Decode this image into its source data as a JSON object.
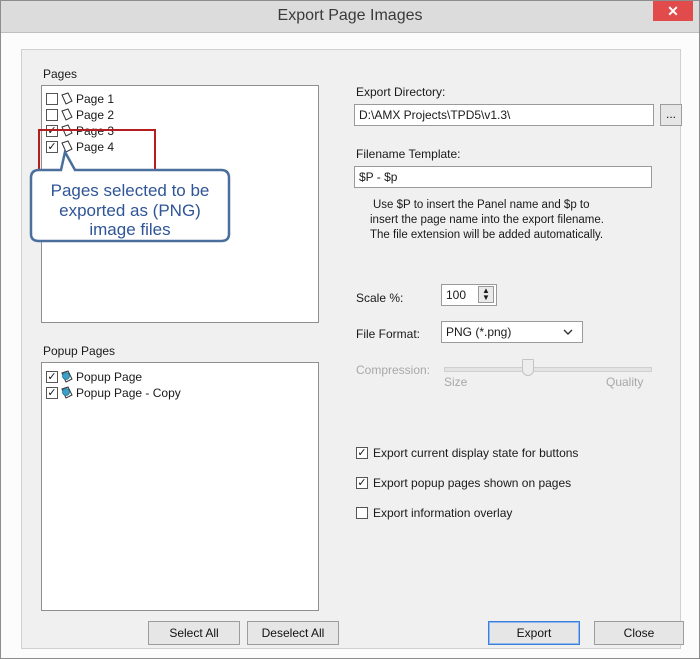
{
  "window": {
    "title": "Export Page Images",
    "close_glyph": "✕"
  },
  "pages": {
    "label": "Pages",
    "items": [
      {
        "label": "Page 1",
        "checked": false
      },
      {
        "label": "Page 2",
        "checked": false
      },
      {
        "label": "Page 3",
        "checked": true
      },
      {
        "label": "Page 4",
        "checked": true
      }
    ],
    "callout": [
      "Pages selected to be",
      "exported as (PNG)",
      "image files"
    ]
  },
  "popup_pages": {
    "label": "Popup Pages",
    "items": [
      {
        "label": "Popup Page",
        "checked": true
      },
      {
        "label": "Popup Page - Copy",
        "checked": true
      }
    ]
  },
  "export_directory": {
    "label": "Export Directory:",
    "value": "D:\\AMX Projects\\TPD5\\v1.3\\",
    "browse_label": "..."
  },
  "filename_template": {
    "label": "Filename Template:",
    "value": "$P - $p",
    "help": [
      "Use $P to insert the Panel name and $p to",
      "insert the page name into the export filename.",
      "The file extension will be added automatically."
    ]
  },
  "scale": {
    "label": "Scale %:",
    "value": "100"
  },
  "file_format": {
    "label": "File Format:",
    "value": "PNG (*.png)"
  },
  "compression": {
    "label": "Compression:",
    "min_label": "Size",
    "max_label": "Quality",
    "level": 0.4
  },
  "options": [
    {
      "label": "Export current display state for buttons",
      "checked": true
    },
    {
      "label": "Export popup pages shown on pages",
      "checked": true
    },
    {
      "label": "Export information overlay",
      "checked": false
    }
  ],
  "buttons": {
    "select_all": "Select All",
    "deselect_all": "Deselect All",
    "export": "Export",
    "close": "Close"
  },
  "colors": {
    "highlight": "#b41e1e",
    "callout_border": "#4a6f9c",
    "callout_text": "#2f5597",
    "primary_border": "#3c7fd8"
  }
}
